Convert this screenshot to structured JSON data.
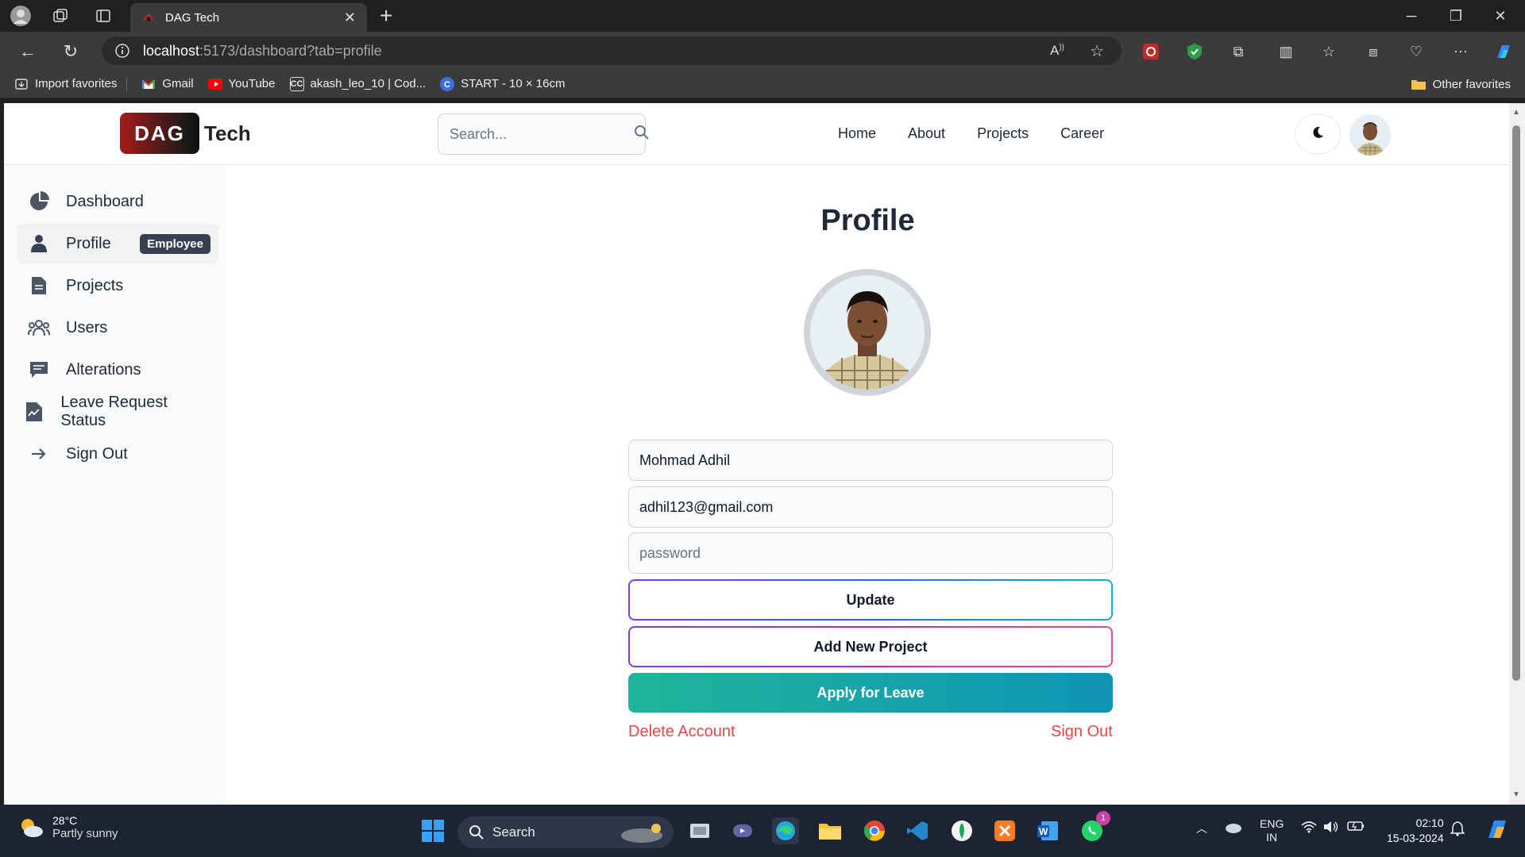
{
  "browser": {
    "tab_title": "DAG Tech",
    "url_host": "localhost",
    "url_path": ":5173/dashboard?tab=profile",
    "favorites": [
      {
        "label": "Import favorites",
        "icon": "import-icon"
      },
      {
        "label": "Gmail",
        "icon": "gmail-icon"
      },
      {
        "label": "YouTube",
        "icon": "youtube-icon"
      },
      {
        "label": "akash_leo_10 | Cod...",
        "icon": "codechef-icon"
      },
      {
        "label": "START - 10 × 16cm",
        "icon": "canva-icon"
      }
    ],
    "other_favorites": "Other favorites"
  },
  "header": {
    "logo_badge": "DAG",
    "logo_text": "Tech",
    "search_placeholder": "Search...",
    "nav": [
      "Home",
      "About",
      "Projects",
      "Career"
    ]
  },
  "sidebar": {
    "items": [
      {
        "label": "Dashboard",
        "icon": "pie-chart-icon"
      },
      {
        "label": "Profile",
        "icon": "user-icon",
        "badge": "Employee"
      },
      {
        "label": "Projects",
        "icon": "document-icon"
      },
      {
        "label": "Users",
        "icon": "users-icon"
      },
      {
        "label": "Alterations",
        "icon": "message-icon"
      },
      {
        "label": "Leave Request Status",
        "icon": "file-chart-icon"
      },
      {
        "label": "Sign Out",
        "icon": "arrow-right-icon"
      }
    ]
  },
  "profile": {
    "title": "Profile",
    "username": "Mohmad Adhil",
    "email": "adhil123@gmail.com",
    "password_placeholder": "password",
    "update_label": "Update",
    "add_project_label": "Add New Project",
    "apply_leave_label": "Apply for Leave",
    "delete_label": "Delete Account",
    "signout_label": "Sign Out"
  },
  "taskbar": {
    "temperature": "28°C",
    "condition": "Partly sunny",
    "search_label": "Search",
    "lang_top": "ENG",
    "lang_bottom": "IN",
    "time": "02:10",
    "date": "15-03-2024",
    "whatsapp_badge": "1"
  },
  "colors": {
    "accent_red": "#ef4444",
    "leave_gradient_start": "#1fb59a",
    "leave_gradient_end": "#0f94b5",
    "badge_bg": "#374151"
  }
}
